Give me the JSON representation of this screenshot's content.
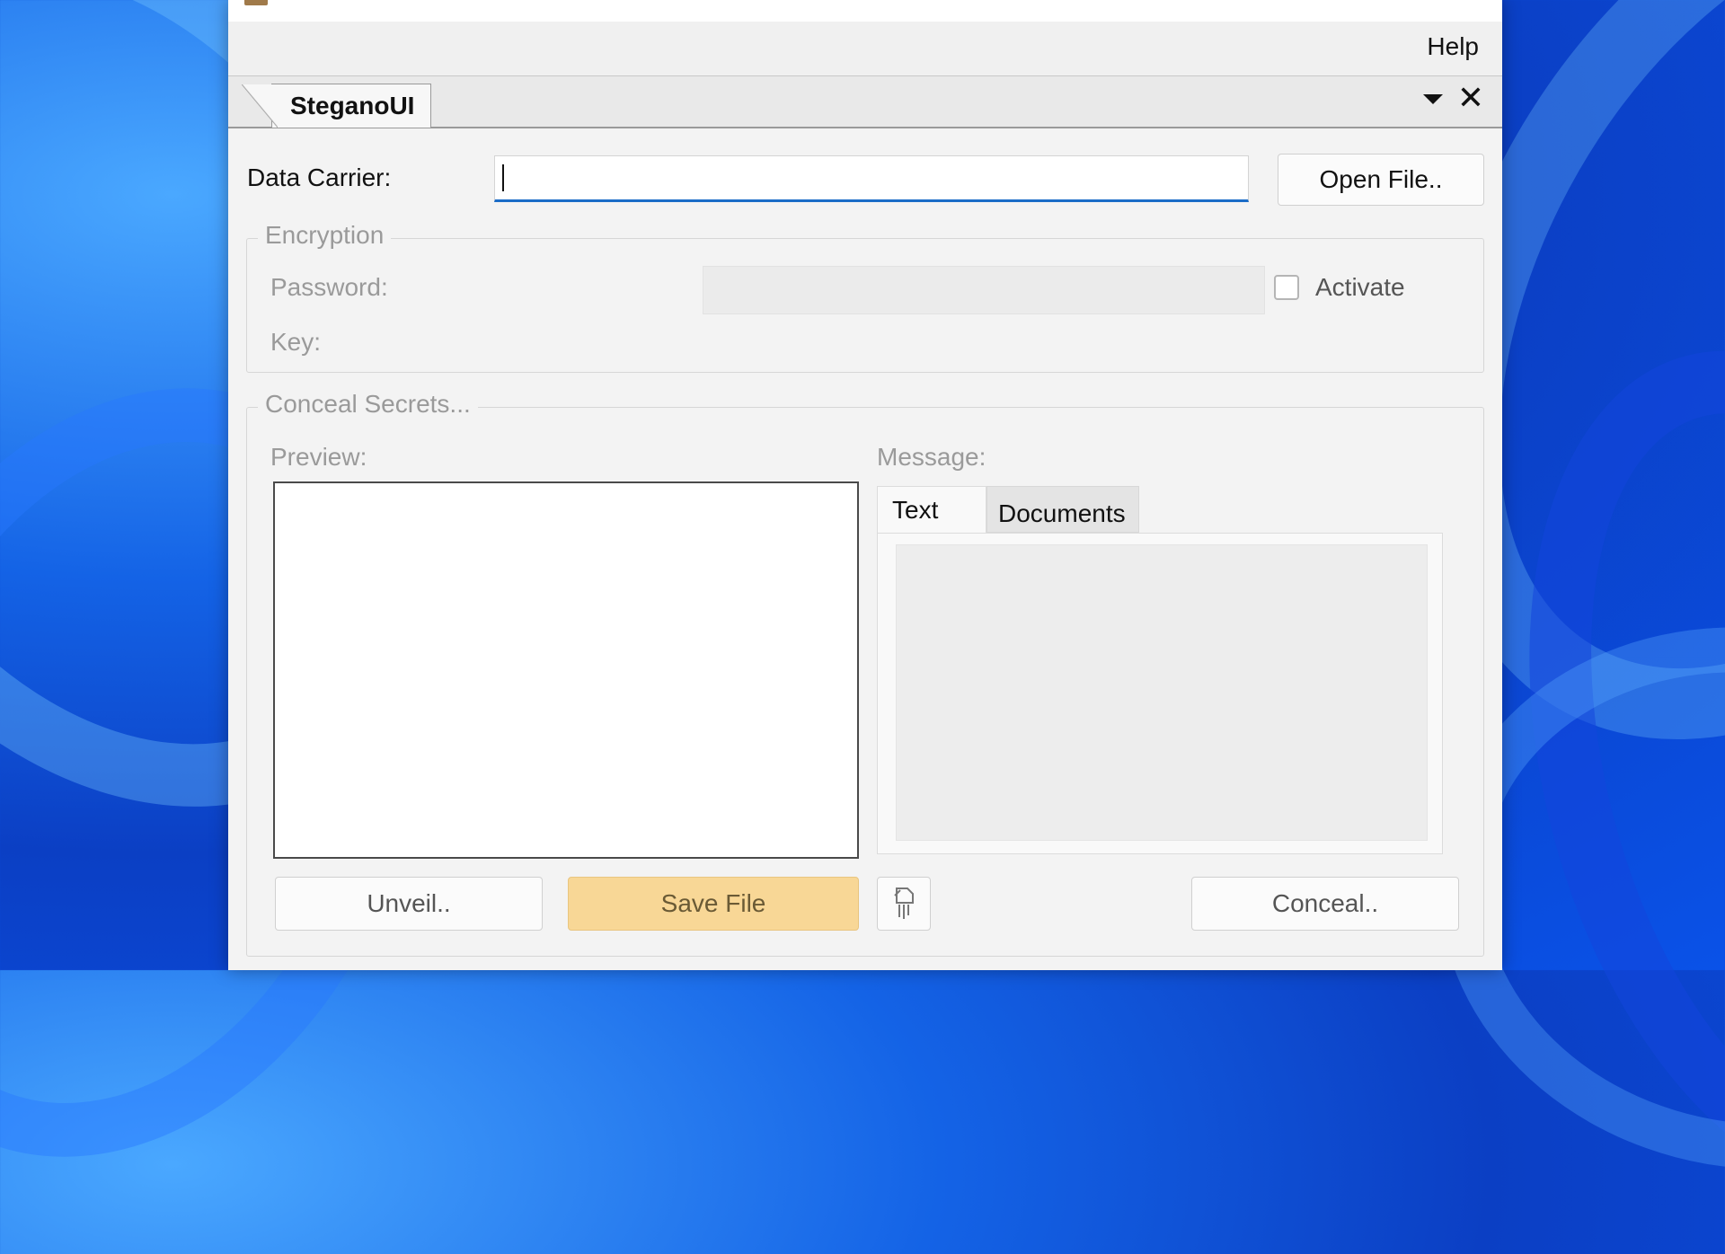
{
  "menu": {
    "help": "Help"
  },
  "doc_tab": {
    "label": "SteganoUI"
  },
  "data_carrier": {
    "label": "Data Carrier:",
    "value": "",
    "open_button": "Open File.."
  },
  "encryption": {
    "title": "Encryption",
    "password_label": "Password:",
    "password_value": "",
    "key_label": "Key:",
    "activate_label": "Activate",
    "activate_checked": false
  },
  "conceal": {
    "title": "Conceal Secrets...",
    "preview_label": "Preview:",
    "message_label": "Message:",
    "tabs": [
      {
        "label": "Text",
        "active": true
      },
      {
        "label": "Documents",
        "active": false
      }
    ],
    "message_text": "",
    "unveil_button": "Unveil..",
    "save_button": "Save File",
    "conceal_button": "Conceal.."
  },
  "icons": {
    "tab_menu": "chevron-down-icon",
    "tab_close": "close-icon",
    "shred": "document-shred-icon"
  }
}
